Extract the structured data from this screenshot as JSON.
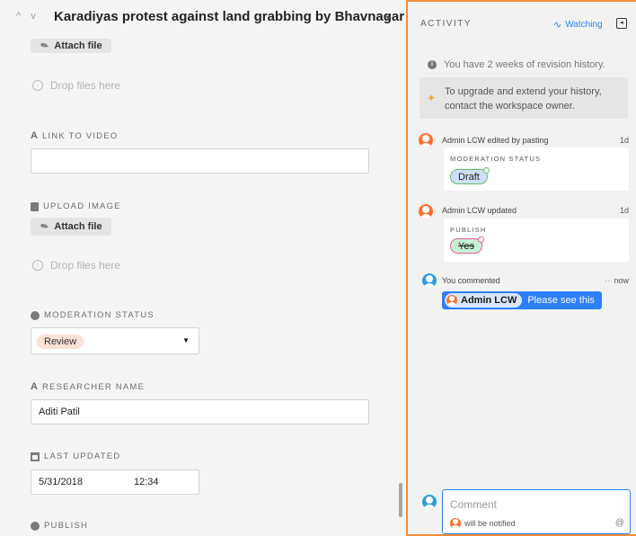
{
  "record": {
    "nav_arrows": "^ v",
    "title": "Karadiyas protest against land grabbing by Bhavnagar ...",
    "menu_icon": "dropdown-caret"
  },
  "fields": {
    "attach_label": "Attach file",
    "drop_label": "Drop files here",
    "link_to_video": {
      "label": "LINK TO VIDEO",
      "value": ""
    },
    "upload_image": {
      "label": "UPLOAD IMAGE"
    },
    "moderation_status": {
      "label": "MODERATION STATUS",
      "value": "Review"
    },
    "researcher_name": {
      "label": "RESEARCHER NAME",
      "value": "Aditi Patil"
    },
    "last_updated": {
      "label": "LAST UPDATED",
      "date": "5/31/2018",
      "time": "12:34"
    },
    "publish": {
      "label": "PUBLISH"
    }
  },
  "activity": {
    "title": "ACTIVITY",
    "watching_label": "Watching",
    "revision_notice": "You have 2 weeks of revision history.",
    "upgrade_notice": "To upgrade and extend your history, contact the workspace owner.",
    "entries": [
      {
        "actor_line": "Admin LCW edited by pasting",
        "time": "1d",
        "field": "MODERATION STATUS",
        "value": "Draft"
      },
      {
        "actor_line": "Admin LCW updated",
        "time": "1d",
        "field": "PUBLISH",
        "value": "Yes"
      }
    ],
    "comment": {
      "actor_line": "You commented",
      "more": "···",
      "time": "now",
      "mention": "Admin LCW",
      "text": "Please see this"
    },
    "composer": {
      "placeholder": "Comment",
      "notify_text": "will be notified",
      "at_symbol": "@"
    }
  },
  "colors": {
    "accent": "#2d7ff9",
    "panel_border": "#f28c38",
    "avatar_orange": "#ff6f2c",
    "avatar_blue": "#2d9cdb",
    "review_pill": "#fde0d6",
    "draft_chip": "#cfdffb",
    "yes_chip": "#c4f2d4"
  }
}
